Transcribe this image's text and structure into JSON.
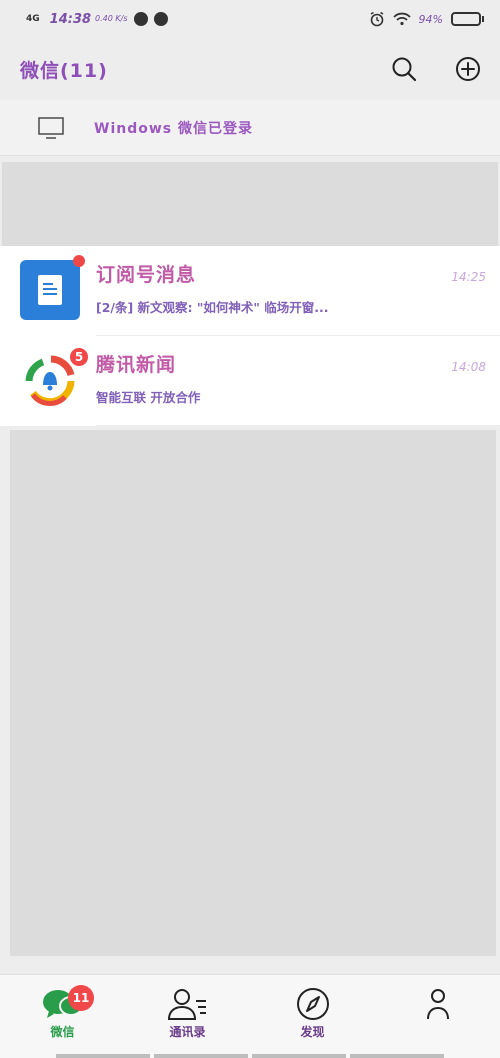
{
  "status": {
    "network": "4G",
    "time": "14:38",
    "speed": "0.40 K/s",
    "battery": "94%",
    "battery_level": 0.94
  },
  "header": {
    "title": "微信(11)",
    "search_icon": "search-icon",
    "add_icon": "plus-circle-icon"
  },
  "login_banner": {
    "text": "Windows 微信已登录",
    "icon": "monitor-icon"
  },
  "chats": [
    {
      "name": "订阅号消息",
      "time": "14:25",
      "preview": "[2/条] 新文观察: \"如何神术\" 临场开窗...",
      "avatar": "subscription-icon",
      "badge": ""
    },
    {
      "name": "腾讯新闻",
      "time": "14:08",
      "preview": "智能互联 开放合作",
      "avatar": "tencent-news-icon",
      "badge": "5"
    }
  ],
  "tabs": [
    {
      "label": "微信",
      "icon": "chat-bubbles-icon",
      "badge": "11",
      "active": true
    },
    {
      "label": "通讯录",
      "icon": "contacts-icon",
      "badge": "",
      "active": false
    },
    {
      "label": "发现",
      "icon": "compass-icon",
      "badge": "",
      "active": false
    },
    {
      "label": "",
      "icon": "person-icon",
      "badge": "",
      "active": false
    }
  ],
  "colors": {
    "accent_green": "#2a9d4a",
    "badge_red": "#f04848",
    "subscription_blue": "#2c7fd8"
  }
}
